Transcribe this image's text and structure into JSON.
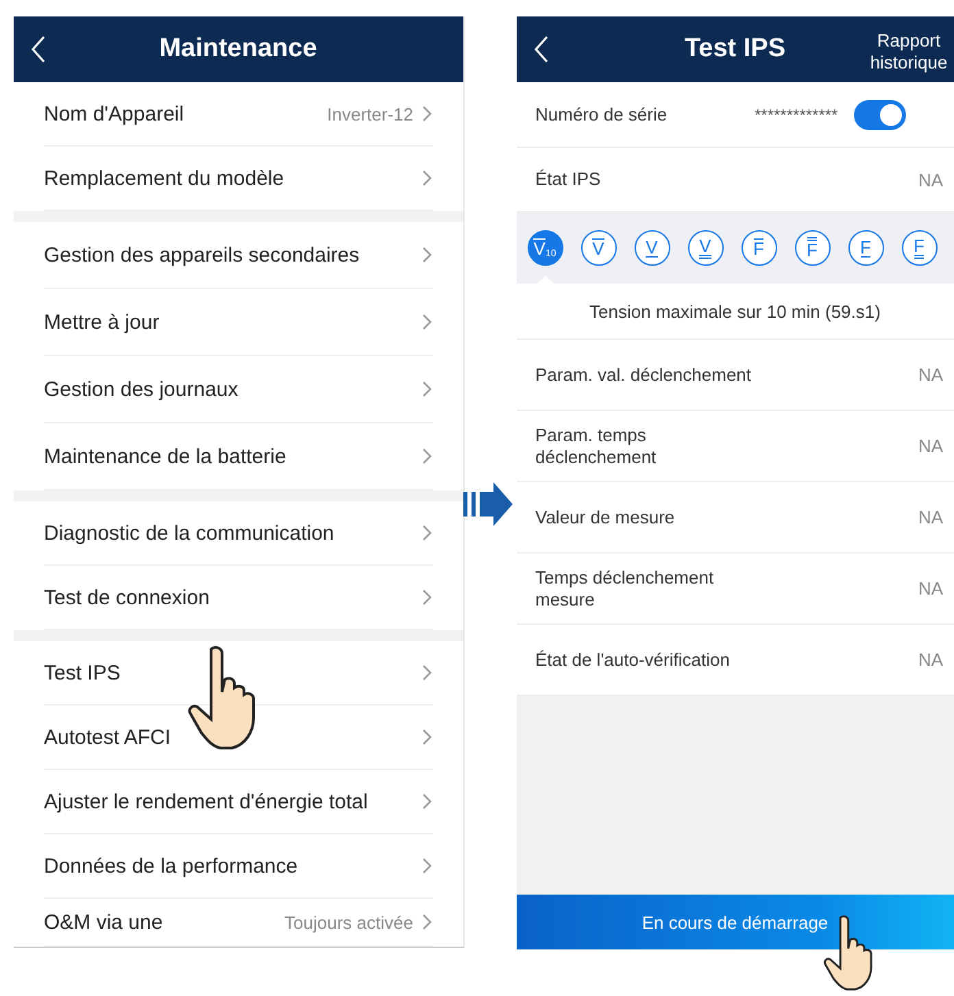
{
  "left_screen": {
    "title": "Maintenance",
    "groups": [
      {
        "items": [
          {
            "label": "Nom d'Appareil",
            "value": "Inverter-12"
          },
          {
            "label": "Remplacement du modèle"
          }
        ]
      },
      {
        "items": [
          {
            "label": "Gestion des appareils secondaires"
          },
          {
            "label": "Mettre à jour"
          },
          {
            "label": "Gestion des journaux"
          },
          {
            "label": "Maintenance de la batterie"
          }
        ]
      },
      {
        "items": [
          {
            "label": "Diagnostic de la communication"
          },
          {
            "label": "Test de connexion"
          }
        ]
      },
      {
        "items": [
          {
            "label": "Test IPS"
          },
          {
            "label": "Autotest AFCI"
          },
          {
            "label": "Ajuster le rendement d'énergie total"
          },
          {
            "label": "Données de la performance"
          },
          {
            "label": "O&M via une",
            "value": "Toujours activée"
          }
        ]
      }
    ]
  },
  "right_screen": {
    "title": "Test IPS",
    "header_action": "Rapport historique",
    "serial": {
      "label": "Numéro de série",
      "value": "*************",
      "on": true
    },
    "state": {
      "label": "État IPS",
      "value": "NA"
    },
    "test_icons": [
      {
        "letter": "V",
        "sub": "10",
        "kind": "overline",
        "selected": true
      },
      {
        "letter": "V",
        "kind": "overline",
        "selected": false
      },
      {
        "letter": "V",
        "kind": "underline",
        "selected": false
      },
      {
        "letter": "V",
        "kind": "underline2",
        "selected": false
      },
      {
        "letter": "F",
        "kind": "overline",
        "selected": false
      },
      {
        "letter": "F",
        "kind": "overline2",
        "selected": false
      },
      {
        "letter": "F",
        "kind": "underline",
        "selected": false
      },
      {
        "letter": "F",
        "kind": "underline2",
        "selected": false
      }
    ],
    "selected_test": "Tension maximale sur 10 min (59.s1)",
    "rows": [
      {
        "label": "Param. val. déclenchement",
        "value": "NA"
      },
      {
        "label": "Param. temps déclenchement",
        "value": "NA"
      },
      {
        "label": "Valeur de mesure",
        "value": "NA"
      },
      {
        "label": "Temps déclenchement mesure",
        "value": "NA"
      },
      {
        "label": "État de l'auto-vérification",
        "value": "NA"
      }
    ],
    "button": "En cours de démarrage"
  }
}
